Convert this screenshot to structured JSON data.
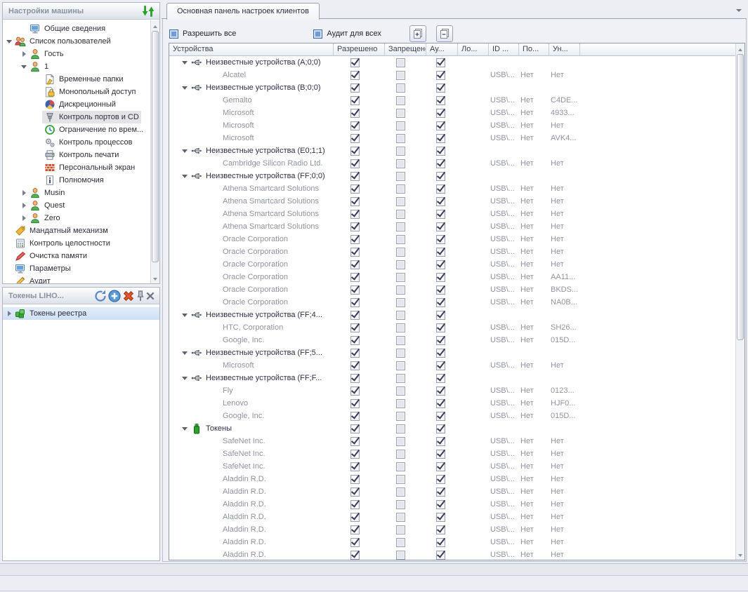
{
  "colors": {
    "accent_green": "#28a228",
    "accent_blue": "#5b9bd5",
    "danger_red": "#d84a28",
    "token_green": "#2ea22e",
    "check_navy": "#3c3c58",
    "panel_title_gray": "#8d91a0"
  },
  "sidebar": {
    "settings_panel": {
      "title": "Настройки машины",
      "tree": [
        {
          "key": "general-info",
          "label": "Общие сведения",
          "icon": "monitor",
          "level": 1,
          "arrow": "none"
        },
        {
          "key": "user-list",
          "label": "Список пользователей",
          "icon": "users",
          "level": 0,
          "arrow": "expanded"
        },
        {
          "key": "guest",
          "label": "Гость",
          "icon": "user",
          "level": 1,
          "arrow": "collapsed"
        },
        {
          "key": "user-1",
          "label": "1",
          "icon": "user",
          "level": 1,
          "arrow": "expanded"
        },
        {
          "key": "temp-folders",
          "label": "Временные папки",
          "icon": "document",
          "level": 2,
          "arrow": "none"
        },
        {
          "key": "exclusive-access",
          "label": "Монопольный доступ",
          "icon": "lock",
          "level": 2,
          "arrow": "none"
        },
        {
          "key": "discretionary",
          "label": "Дискреционный",
          "icon": "pie",
          "level": 2,
          "arrow": "none"
        },
        {
          "key": "ports-cd-control",
          "label": "Контроль портов и CD",
          "icon": "ports",
          "level": 2,
          "arrow": "none",
          "selected": true
        },
        {
          "key": "time-limit",
          "label": "Ограничение по врем...",
          "icon": "clock",
          "level": 2,
          "arrow": "none"
        },
        {
          "key": "process-control",
          "label": "Контроль процессов",
          "icon": "process",
          "level": 2,
          "arrow": "none"
        },
        {
          "key": "print-control",
          "label": "Контроль печати",
          "icon": "printer",
          "level": 2,
          "arrow": "none"
        },
        {
          "key": "personal-screen",
          "label": "Персональный экран",
          "icon": "firewall",
          "level": 2,
          "arrow": "none"
        },
        {
          "key": "privileges",
          "label": "Полномочия",
          "icon": "info",
          "level": 2,
          "arrow": "none"
        },
        {
          "key": "user-musin",
          "label": "Musin",
          "icon": "user",
          "level": 1,
          "arrow": "collapsed"
        },
        {
          "key": "user-quest",
          "label": "Quest",
          "icon": "user",
          "level": 1,
          "arrow": "collapsed"
        },
        {
          "key": "user-zero",
          "label": "Zero",
          "icon": "user",
          "level": 1,
          "arrow": "collapsed"
        },
        {
          "key": "mandatory",
          "label": "Мандатный механизм",
          "icon": "tag",
          "level": 0,
          "arrow": "none"
        },
        {
          "key": "integrity-control",
          "label": "Контроль целостности",
          "icon": "calc",
          "level": 0,
          "arrow": "none"
        },
        {
          "key": "memory-clean",
          "label": "Очистка памяти",
          "icon": "eraser",
          "level": 0,
          "arrow": "none"
        },
        {
          "key": "parameters",
          "label": "Параметры",
          "icon": "monitor",
          "level": 0,
          "arrow": "none"
        },
        {
          "key": "audit",
          "label": "Аудит",
          "icon": "pencil",
          "level": 0,
          "arrow": "none"
        }
      ]
    },
    "tokens_panel": {
      "title": "Токены LIHO...",
      "tree_item": {
        "key": "registry-tokens",
        "label": "Токены реестра",
        "icon": "registry",
        "arrow": "collapsed"
      }
    }
  },
  "main": {
    "tab": "Основная панель настроек клиентов",
    "toolbar": {
      "allow_all": "Разрешить все",
      "audit_all": "Аудит для всех"
    },
    "table": {
      "columns": [
        "Устройства",
        "Разрешено",
        "Запрещено",
        "Ау...",
        "Ло...",
        "ID ...",
        "По...",
        "Ун..."
      ],
      "rows": [
        {
          "type": "group",
          "icon": "usb",
          "label": "Неизвестные устройства (A;0;0)",
          "allowed": true,
          "denied": false,
          "audit": true
        },
        {
          "type": "device",
          "label": "Alcatel",
          "id": "USB\\...",
          "port": "Нет",
          "unique": "Нет",
          "allowed": true,
          "denied": false,
          "audit": true
        },
        {
          "type": "group",
          "icon": "usb",
          "label": "Неизвестные устройства (B;0;0)",
          "allowed": true,
          "denied": false,
          "audit": true
        },
        {
          "type": "device",
          "label": "Gemalto",
          "id": "USB\\...",
          "port": "Нет",
          "unique": "C4DE...",
          "allowed": true,
          "denied": false,
          "audit": true
        },
        {
          "type": "device",
          "label": "Microsoft",
          "id": "USB\\...",
          "port": "Нет",
          "unique": "4933...",
          "allowed": true,
          "denied": false,
          "audit": true
        },
        {
          "type": "device",
          "label": "Microsoft",
          "id": "USB\\...",
          "port": "Нет",
          "unique": "Нет",
          "allowed": true,
          "denied": false,
          "audit": true
        },
        {
          "type": "device",
          "label": "Microsoft",
          "id": "USB\\...",
          "port": "Нет",
          "unique": "AVK4...",
          "allowed": true,
          "denied": false,
          "audit": true
        },
        {
          "type": "group",
          "icon": "usb",
          "label": "Неизвестные устройства (E0;1;1)",
          "allowed": true,
          "denied": false,
          "audit": true
        },
        {
          "type": "device",
          "label": "Cambridge Silicon Radio Ltd.",
          "id": "USB\\...",
          "port": "Нет",
          "unique": "Нет",
          "allowed": true,
          "denied": false,
          "audit": true
        },
        {
          "type": "group",
          "icon": "usb",
          "label": "Неизвестные устройства (FF;0;0)",
          "allowed": true,
          "denied": false,
          "audit": true
        },
        {
          "type": "device",
          "label": "Athena Smartcard Solutions",
          "id": "USB\\...",
          "port": "Нет",
          "unique": "Нет",
          "allowed": true,
          "denied": false,
          "audit": true
        },
        {
          "type": "device",
          "label": "Athena Smartcard Solutions",
          "id": "USB\\...",
          "port": "Нет",
          "unique": "Нет",
          "allowed": true,
          "denied": false,
          "audit": true
        },
        {
          "type": "device",
          "label": "Athena Smartcard Solutions",
          "id": "USB\\...",
          "port": "Нет",
          "unique": "Нет",
          "allowed": true,
          "denied": false,
          "audit": true
        },
        {
          "type": "device",
          "label": "Athena Smartcard Solutions",
          "id": "USB\\...",
          "port": "Нет",
          "unique": "Нет",
          "allowed": true,
          "denied": false,
          "audit": true
        },
        {
          "type": "device",
          "label": "Oracle Corporation",
          "id": "USB\\...",
          "port": "Нет",
          "unique": "Нет",
          "allowed": true,
          "denied": false,
          "audit": true
        },
        {
          "type": "device",
          "label": "Oracle Corporation",
          "id": "USB\\...",
          "port": "Нет",
          "unique": "Нет",
          "allowed": true,
          "denied": false,
          "audit": true
        },
        {
          "type": "device",
          "label": "Oracle Corporation",
          "id": "USB\\...",
          "port": "Нет",
          "unique": "Нет",
          "allowed": true,
          "denied": false,
          "audit": true
        },
        {
          "type": "device",
          "label": "Oracle Corporation",
          "id": "USB\\...",
          "port": "Нет",
          "unique": "AA11...",
          "allowed": true,
          "denied": false,
          "audit": true
        },
        {
          "type": "device",
          "label": "Oracle Corporation",
          "id": "USB\\...",
          "port": "Нет",
          "unique": "BKDS...",
          "allowed": true,
          "denied": false,
          "audit": true
        },
        {
          "type": "device",
          "label": "Oracle Corporation",
          "id": "USB\\...",
          "port": "Нет",
          "unique": "NA0B...",
          "allowed": true,
          "denied": false,
          "audit": true
        },
        {
          "type": "group",
          "icon": "usb",
          "label": "Неизвестные устройства (FF;4...",
          "allowed": true,
          "denied": false,
          "audit": true
        },
        {
          "type": "device",
          "label": "HTC, Corporation",
          "id": "USB\\...",
          "port": "Нет",
          "unique": "SH26...",
          "allowed": true,
          "denied": false,
          "audit": true
        },
        {
          "type": "device",
          "label": "Google, Inc.",
          "id": "USB\\...",
          "port": "Нет",
          "unique": "015D...",
          "allowed": true,
          "denied": false,
          "audit": true
        },
        {
          "type": "group",
          "icon": "usb",
          "label": "Неизвестные устройства (FF;5...",
          "allowed": true,
          "denied": false,
          "audit": true
        },
        {
          "type": "device",
          "label": "Microsoft",
          "id": "USB\\...",
          "port": "Нет",
          "unique": "Нет",
          "allowed": true,
          "denied": false,
          "audit": true
        },
        {
          "type": "group",
          "icon": "usb",
          "label": "Неизвестные устройства (FF;F...",
          "allowed": true,
          "denied": false,
          "audit": true
        },
        {
          "type": "device",
          "label": "Fly",
          "id": "USB\\...",
          "port": "Нет",
          "unique": "0123...",
          "allowed": true,
          "denied": false,
          "audit": true
        },
        {
          "type": "device",
          "label": "Lenovo",
          "id": "USB\\...",
          "port": "Нет",
          "unique": "HJF0...",
          "allowed": true,
          "denied": false,
          "audit": true
        },
        {
          "type": "device",
          "label": "Google, Inc.",
          "id": "USB\\...",
          "port": "Нет",
          "unique": "015D...",
          "allowed": true,
          "denied": false,
          "audit": true
        },
        {
          "type": "group",
          "icon": "token",
          "label": "Токены",
          "allowed": true,
          "denied": false,
          "audit": true
        },
        {
          "type": "device",
          "label": "SafeNet Inc.",
          "id": "USB\\...",
          "port": "Нет",
          "unique": "Нет",
          "allowed": true,
          "denied": false,
          "audit": true
        },
        {
          "type": "device",
          "label": "SafeNet Inc.",
          "id": "USB\\...",
          "port": "Нет",
          "unique": "Нет",
          "allowed": true,
          "denied": false,
          "audit": true
        },
        {
          "type": "device",
          "label": "SafeNet Inc.",
          "id": "USB\\...",
          "port": "Нет",
          "unique": "Нет",
          "allowed": true,
          "denied": false,
          "audit": true
        },
        {
          "type": "device",
          "label": "Aladdin R.D.",
          "id": "USB\\...",
          "port": "Нет",
          "unique": "Нет",
          "allowed": true,
          "denied": false,
          "audit": true
        },
        {
          "type": "device",
          "label": "Aladdin R.D.",
          "id": "USB\\...",
          "port": "Нет",
          "unique": "Нет",
          "allowed": true,
          "denied": false,
          "audit": true
        },
        {
          "type": "device",
          "label": "Aladdin R.D.",
          "id": "USB\\...",
          "port": "Нет",
          "unique": "Нет",
          "allowed": true,
          "denied": false,
          "audit": true
        },
        {
          "type": "device",
          "label": "Aladdin R.D.",
          "id": "USB\\...",
          "port": "Нет",
          "unique": "Нет",
          "allowed": true,
          "denied": false,
          "audit": true
        },
        {
          "type": "device",
          "label": "Aladdin R.D.",
          "id": "USB\\...",
          "port": "Нет",
          "unique": "Нет",
          "allowed": true,
          "denied": false,
          "audit": true
        },
        {
          "type": "device",
          "label": "Aladdin R.D.",
          "id": "USB\\...",
          "port": "Нет",
          "unique": "Нет",
          "allowed": true,
          "denied": false,
          "audit": true
        },
        {
          "type": "device",
          "label": "Aladdin R.D.",
          "id": "USB\\...",
          "port": "Нет",
          "unique": "Нет",
          "allowed": true,
          "denied": false,
          "audit": true
        }
      ]
    }
  }
}
